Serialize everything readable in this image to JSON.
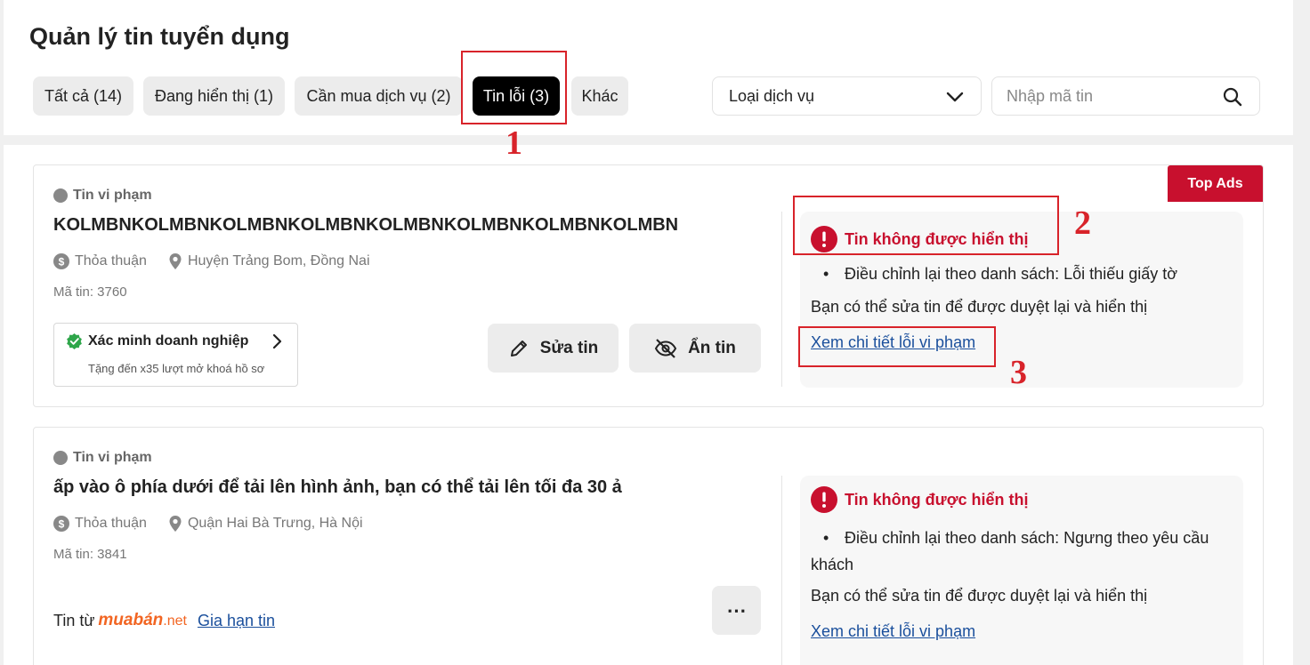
{
  "page": {
    "title": "Quản lý tin tuyển dụng"
  },
  "tabs": [
    {
      "label": "Tất cả (14)",
      "active": false
    },
    {
      "label": "Đang hiển thị (1)",
      "active": false
    },
    {
      "label": "Cần mua dịch vụ (2)",
      "active": false
    },
    {
      "label": "Tin lỗi (3)",
      "active": true
    },
    {
      "label": "Khác",
      "active": false
    }
  ],
  "filters": {
    "service_select": "Loại dịch vụ",
    "search_placeholder": "Nhập mã tin"
  },
  "jobs": [
    {
      "status": "Tin vi phạm",
      "title": "KOLMBNKOLMBNKOLMBNKOLMBNKOLMBNKOLMBNKOLMBNKOLMBN",
      "salary": "Thỏa thuận",
      "location": "Huyện Trảng Bom, Đồng Nai",
      "code": "Mã tin: 3760",
      "badge": "Top Ads",
      "verify_title": "Xác minh doanh nghiệp",
      "verify_sub": "Tặng đến x35 lượt mở khoá hồ sơ",
      "edit_label": "Sửa tin",
      "hide_label": "Ẩn tin",
      "error_title": "Tin không được hiển thị",
      "error_item": "Điều chỉnh lại theo danh sách: Lỗi thiếu giấy tờ",
      "error_note": "Bạn có thể sửa tin để được duyệt lại và hiển thị",
      "error_link": "Xem chi tiết lỗi vi phạm"
    },
    {
      "status": "Tin vi phạm",
      "title": "ấp vào ô phía dưới để tải lên hình ảnh, bạn có thể tải lên tối đa 30 ả",
      "salary": "Thỏa thuận",
      "location": "Quận Hai Bà Trưng, Hà Nội",
      "code": "Mã tin: 3841",
      "source_prefix": "Tin từ",
      "source_brand": "muabán",
      "source_suffix": ".net",
      "renew_label": "Gia hạn tin",
      "more_label": "⋯",
      "error_title": "Tin không được hiển thị",
      "error_item_line1": "Điều chỉnh lại theo danh sách: Ngưng theo yêu cầu",
      "error_item_line2": "khách",
      "error_note": "Bạn có thể sửa tin để được duyệt lại và hiển thị",
      "error_link": "Xem chi tiết lỗi vi phạm"
    }
  ],
  "annotations": [
    "1",
    "2",
    "3"
  ],
  "colors": {
    "accent_red": "#c8102e",
    "annotation_red": "#d8232a",
    "link_blue": "#1a4f9c",
    "brand_orange": "#f26522"
  }
}
